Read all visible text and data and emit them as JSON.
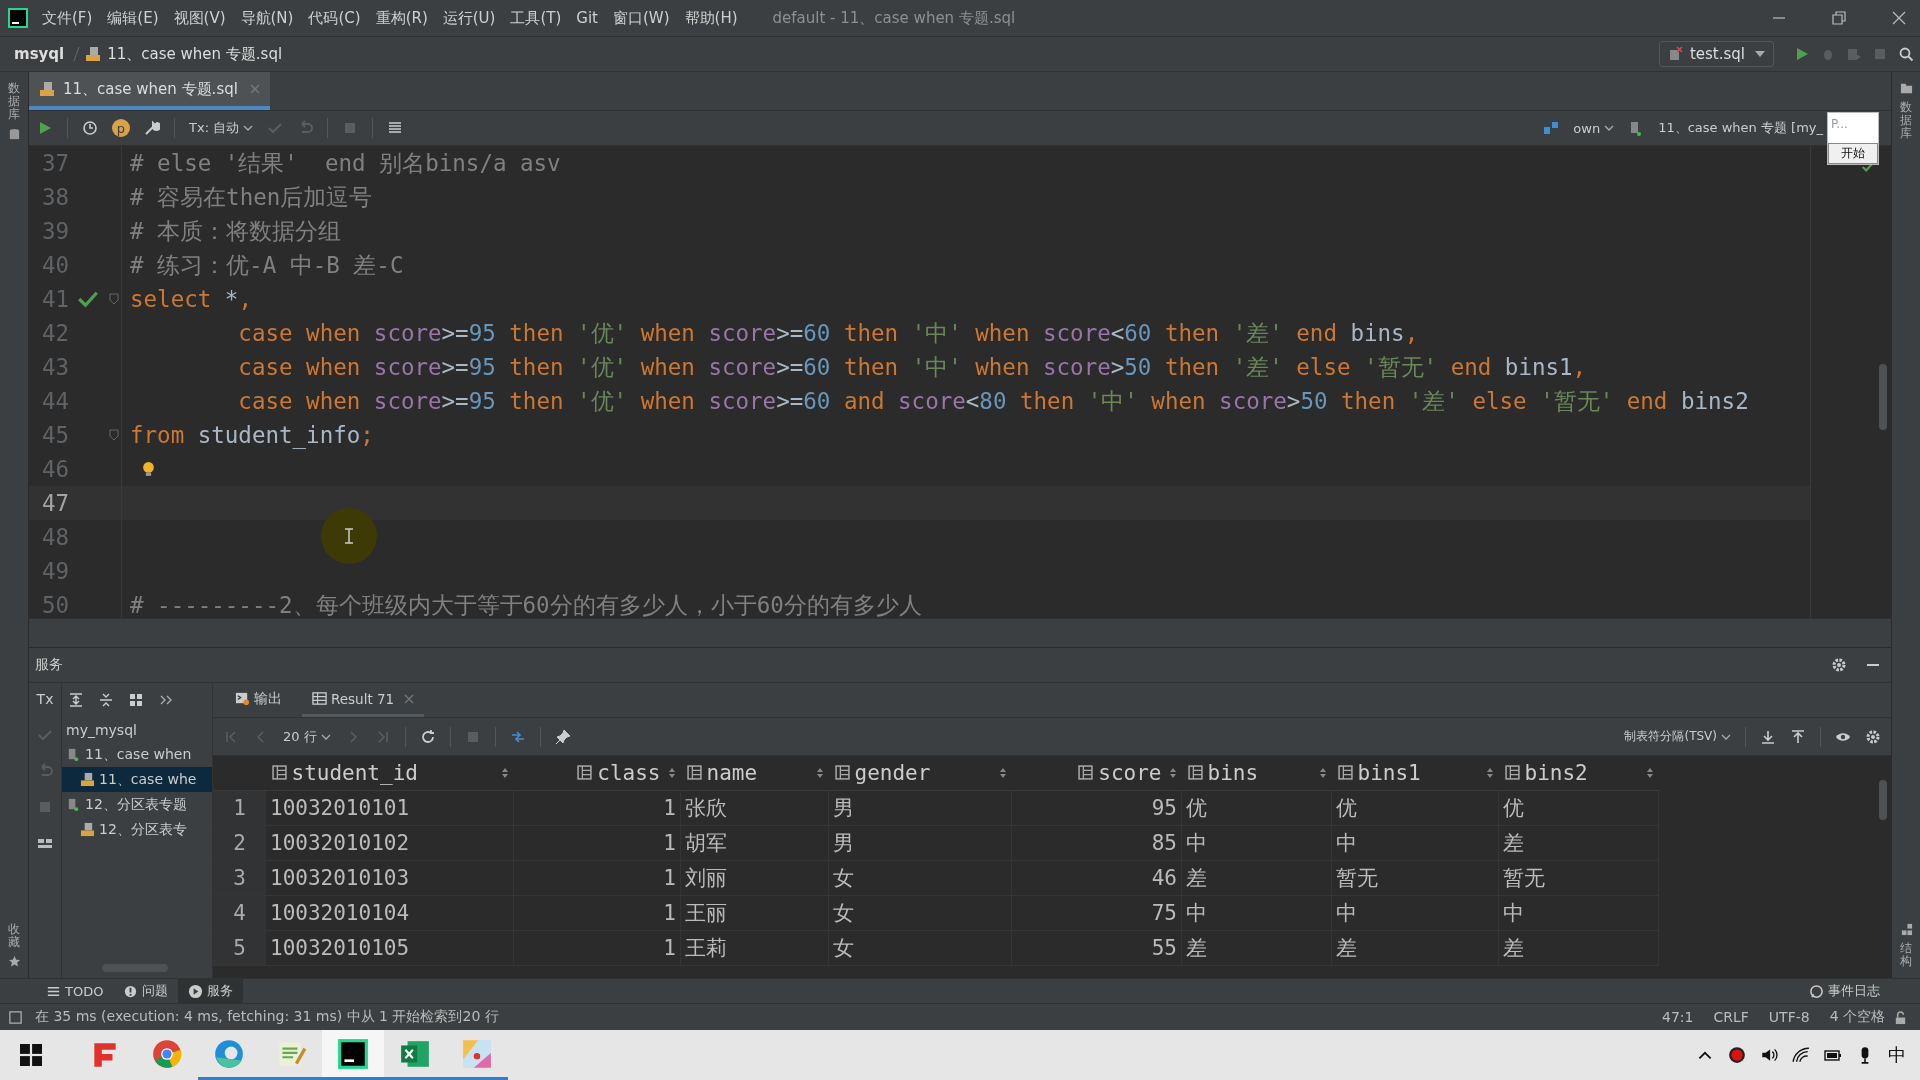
{
  "window": {
    "title": "default - 11、case when 专题.sql",
    "menu": [
      "文件(F)",
      "编辑(E)",
      "视图(V)",
      "导航(N)",
      "代码(C)",
      "重构(R)",
      "运行(U)",
      "工具(T)",
      "Git",
      "窗口(W)",
      "帮助(H)"
    ]
  },
  "navbar": {
    "project": "msyql",
    "file": "11、case when 专题.sql",
    "run_config": "test.sql"
  },
  "editor_tabs": [
    {
      "label": "11、case when 专题.sql",
      "selected": true
    }
  ],
  "editor_toolbar": {
    "badge": "p",
    "tx": "Tx: 自动",
    "schema": "own",
    "session": "11、case when 专题 [my_"
  },
  "popup": {
    "text": "P...",
    "button": "开始"
  },
  "left_strip": {
    "top": "数据库",
    "bottom": "收藏"
  },
  "right_strip": {
    "top": "数据库",
    "bottom": "结构"
  },
  "code": [
    {
      "number": "37",
      "current": false,
      "fold": false,
      "kind": "plain",
      "tokens": [
        {
          "kind": "comment",
          "text": "# else '结果'  end 别名bins/a asv"
        }
      ]
    },
    {
      "number": "38",
      "current": false,
      "fold": false,
      "kind": "plain",
      "tokens": [
        {
          "kind": "comment",
          "text": "# 容易在then后加逗号"
        }
      ]
    },
    {
      "number": "39",
      "current": false,
      "fold": false,
      "kind": "plain",
      "tokens": [
        {
          "kind": "comment",
          "text": "# 本质：将数据分组"
        }
      ]
    },
    {
      "number": "40",
      "current": false,
      "fold": false,
      "kind": "plain",
      "tokens": [
        {
          "kind": "comment",
          "text": "# 练习：优-A 中-B 差-C"
        }
      ]
    },
    {
      "number": "41",
      "current": false,
      "fold": true,
      "kind": "executed",
      "tokens": [
        {
          "kind": "kw",
          "text": "select"
        },
        {
          "kind": "plain",
          "text": " *"
        },
        {
          "kind": "kw",
          "text": ","
        }
      ]
    },
    {
      "number": "42",
      "current": false,
      "fold": false,
      "kind": "plain",
      "tokens": [
        {
          "kind": "kw",
          "text": "        case when "
        },
        {
          "kind": "col",
          "text": "score"
        },
        {
          "kind": "plain",
          "text": ">="
        },
        {
          "kind": "num",
          "text": "95"
        },
        {
          "kind": "kw",
          "text": " then "
        },
        {
          "kind": "str",
          "text": "'优'"
        },
        {
          "kind": "kw",
          "text": " when "
        },
        {
          "kind": "col",
          "text": "score"
        },
        {
          "kind": "plain",
          "text": ">="
        },
        {
          "kind": "num",
          "text": "60"
        },
        {
          "kind": "kw",
          "text": " then "
        },
        {
          "kind": "str",
          "text": "'中'"
        },
        {
          "kind": "kw",
          "text": " when "
        },
        {
          "kind": "col",
          "text": "score"
        },
        {
          "kind": "plain",
          "text": "<"
        },
        {
          "kind": "num",
          "text": "60"
        },
        {
          "kind": "kw",
          "text": " then "
        },
        {
          "kind": "str",
          "text": "'差'"
        },
        {
          "kind": "kw",
          "text": " end"
        },
        {
          "kind": "plain",
          "text": " bins"
        },
        {
          "kind": "kw",
          "text": ","
        }
      ]
    },
    {
      "number": "43",
      "current": false,
      "fold": false,
      "kind": "plain",
      "tokens": [
        {
          "kind": "kw",
          "text": "        case when "
        },
        {
          "kind": "col",
          "text": "score"
        },
        {
          "kind": "plain",
          "text": ">="
        },
        {
          "kind": "num",
          "text": "95"
        },
        {
          "kind": "kw",
          "text": " then "
        },
        {
          "kind": "str",
          "text": "'优'"
        },
        {
          "kind": "kw",
          "text": " when "
        },
        {
          "kind": "col",
          "text": "score"
        },
        {
          "kind": "plain",
          "text": ">="
        },
        {
          "kind": "num",
          "text": "60"
        },
        {
          "kind": "kw",
          "text": " then "
        },
        {
          "kind": "str",
          "text": "'中'"
        },
        {
          "kind": "kw",
          "text": " when "
        },
        {
          "kind": "col",
          "text": "score"
        },
        {
          "kind": "plain",
          "text": ">"
        },
        {
          "kind": "num",
          "text": "50"
        },
        {
          "kind": "kw",
          "text": " then "
        },
        {
          "kind": "str",
          "text": "'差'"
        },
        {
          "kind": "kw",
          "text": " else "
        },
        {
          "kind": "str",
          "text": "'暂无'"
        },
        {
          "kind": "kw",
          "text": " end"
        },
        {
          "kind": "plain",
          "text": " bins1"
        },
        {
          "kind": "kw",
          "text": ","
        }
      ]
    },
    {
      "number": "44",
      "current": false,
      "fold": false,
      "kind": "plain",
      "tokens": [
        {
          "kind": "kw",
          "text": "        case when "
        },
        {
          "kind": "col",
          "text": "score"
        },
        {
          "kind": "plain",
          "text": ">="
        },
        {
          "kind": "num",
          "text": "95"
        },
        {
          "kind": "kw",
          "text": " then "
        },
        {
          "kind": "str",
          "text": "'优'"
        },
        {
          "kind": "kw",
          "text": " when "
        },
        {
          "kind": "col",
          "text": "score"
        },
        {
          "kind": "plain",
          "text": ">="
        },
        {
          "kind": "num",
          "text": "60"
        },
        {
          "kind": "kw",
          "text": " and "
        },
        {
          "kind": "col",
          "text": "score"
        },
        {
          "kind": "plain",
          "text": "<"
        },
        {
          "kind": "num",
          "text": "80"
        },
        {
          "kind": "kw",
          "text": " then "
        },
        {
          "kind": "str",
          "text": "'中'"
        },
        {
          "kind": "kw",
          "text": " when "
        },
        {
          "kind": "col",
          "text": "score"
        },
        {
          "kind": "plain",
          "text": ">"
        },
        {
          "kind": "num",
          "text": "50"
        },
        {
          "kind": "kw",
          "text": " then "
        },
        {
          "kind": "str",
          "text": "'差'"
        },
        {
          "kind": "kw",
          "text": " else "
        },
        {
          "kind": "str",
          "text": "'暂无'"
        },
        {
          "kind": "kw",
          "text": " end"
        },
        {
          "kind": "plain",
          "text": " bins2"
        }
      ]
    },
    {
      "number": "45",
      "current": false,
      "fold": true,
      "kind": "plain",
      "tokens": [
        {
          "kind": "kw",
          "text": "from"
        },
        {
          "kind": "plain",
          "text": " student_info"
        },
        {
          "kind": "kw",
          "text": ";"
        }
      ]
    },
    {
      "number": "46",
      "current": false,
      "fold": false,
      "kind": "hint"
    },
    {
      "number": "47",
      "current": true,
      "fold": false,
      "kind": "plain"
    },
    {
      "number": "48",
      "current": false,
      "fold": false,
      "kind": "plain"
    },
    {
      "number": "49",
      "current": false,
      "fold": false,
      "kind": "plain"
    },
    {
      "number": "50",
      "current": false,
      "fold": false,
      "kind": "plain",
      "tokens": [
        {
          "kind": "comment",
          "text": "# ---------2、每个班级内大于等于60分的有多少人，小于60分的有多少人"
        }
      ]
    }
  ],
  "services": {
    "title": "服务",
    "tx": "Tx",
    "tree": [
      {
        "label": "my_mysql",
        "selected": false,
        "children": [
          {
            "label": "11、case when",
            "selected": false,
            "children": [
              {
                "label": "11、case whe",
                "selected": true
              }
            ]
          },
          {
            "label": "12、分区表专题",
            "selected": false,
            "children": [
              {
                "label": "12、分区表专",
                "selected": false
              }
            ]
          }
        ]
      }
    ]
  },
  "result_tabs": [
    {
      "label": "输出",
      "kind": "console",
      "selected": false
    },
    {
      "label": "Result 71",
      "kind": "grid",
      "selected": true
    }
  ],
  "result_toolbar": {
    "page_size": "20 行",
    "export_format": "制表符分隔(TSV)"
  },
  "table": {
    "columns": [
      {
        "name": "student_id",
        "right_aligned": false
      },
      {
        "name": "class",
        "right_aligned": true
      },
      {
        "name": "name",
        "right_aligned": false
      },
      {
        "name": "gender",
        "right_aligned": false
      },
      {
        "name": "score",
        "right_aligned": true
      },
      {
        "name": "bins",
        "right_aligned": false
      },
      {
        "name": "bins1",
        "right_aligned": false
      },
      {
        "name": "bins2",
        "right_aligned": false
      }
    ],
    "rows": [
      {
        "index": "1",
        "cells": [
          "10032010101",
          "1",
          "张欣",
          "男",
          "95",
          "优",
          "优",
          "优"
        ]
      },
      {
        "index": "2",
        "cells": [
          "10032010102",
          "1",
          "胡军",
          "男",
          "85",
          "中",
          "中",
          "差"
        ]
      },
      {
        "index": "3",
        "cells": [
          "10032010103",
          "1",
          "刘丽",
          "女",
          "46",
          "差",
          "暂无",
          "暂无"
        ]
      },
      {
        "index": "4",
        "cells": [
          "10032010104",
          "1",
          "王丽",
          "女",
          "75",
          "中",
          "中",
          "中"
        ]
      },
      {
        "index": "5",
        "cells": [
          "10032010105",
          "1",
          "王莉",
          "女",
          "55",
          "差",
          "差",
          "差"
        ]
      }
    ]
  },
  "tool_tabs": [
    {
      "label": "TODO",
      "kind": "list",
      "selected": false
    },
    {
      "label": "问题",
      "kind": "info",
      "selected": false
    },
    {
      "label": "服务",
      "kind": "play",
      "selected": true
    }
  ],
  "event_log": "事件日志",
  "status": {
    "message": "在 35 ms (execution: 4 ms, fetching: 31 ms) 中从 1 开始检索到20 行",
    "position": "47:1",
    "line_separator": "CRLF",
    "encoding": "UTF-8",
    "indent": "4 个空格"
  },
  "taskbar": {
    "apps": [
      {
        "kind": "reader",
        "running": false,
        "selected": false
      },
      {
        "kind": "browser",
        "running": false,
        "selected": false
      },
      {
        "kind": "edge",
        "running": true,
        "selected": false
      },
      {
        "kind": "notepad",
        "running": true,
        "selected": false
      },
      {
        "kind": "ide",
        "running": true,
        "selected": true
      },
      {
        "kind": "sheet",
        "running": true,
        "selected": false
      },
      {
        "kind": "paint",
        "running": true,
        "selected": false
      }
    ],
    "ime": "中"
  }
}
